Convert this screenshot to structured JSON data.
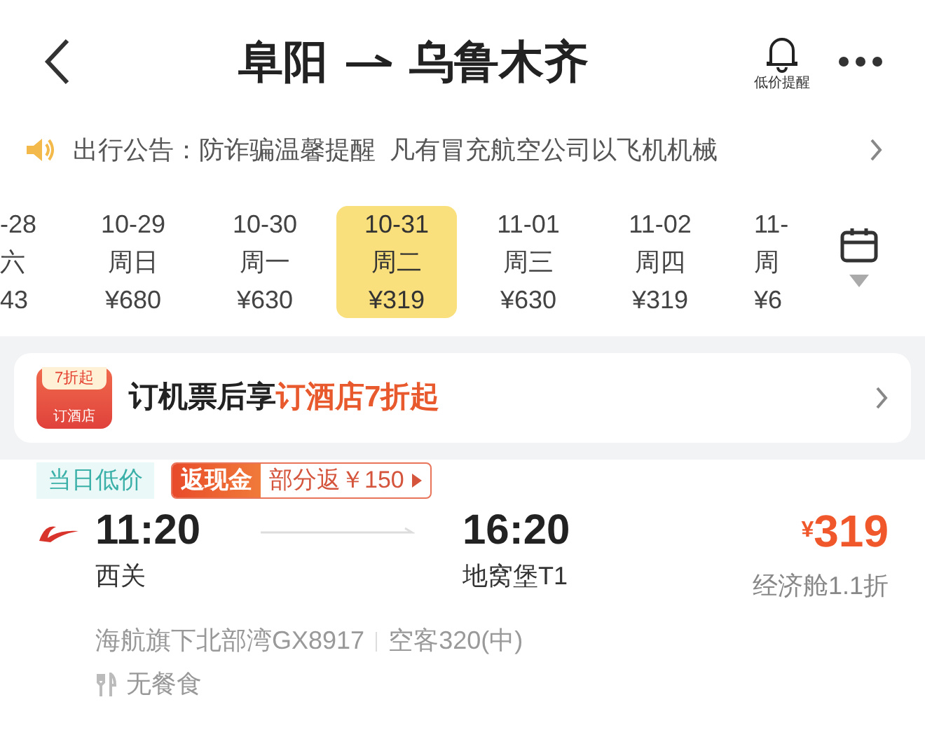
{
  "header": {
    "origin": "阜阳",
    "destination": "乌鲁木齐",
    "price_alert": "低价提醒"
  },
  "notice": {
    "text": "出行公告：防诈骗温馨提醒  凡有冒充航空公司以飞机机械"
  },
  "dates": [
    {
      "date": "-28",
      "weekday": "六",
      "price": "43",
      "selected": false
    },
    {
      "date": "10-29",
      "weekday": "周日",
      "price": "¥680",
      "selected": false
    },
    {
      "date": "10-30",
      "weekday": "周一",
      "price": "¥630",
      "selected": false
    },
    {
      "date": "10-31",
      "weekday": "周二",
      "price": "¥319",
      "selected": true
    },
    {
      "date": "11-01",
      "weekday": "周三",
      "price": "¥630",
      "selected": false
    },
    {
      "date": "11-02",
      "weekday": "周四",
      "price": "¥319",
      "selected": false
    },
    {
      "date": "11-",
      "weekday": "周",
      "price": "¥6",
      "selected": false
    }
  ],
  "promo": {
    "badge_top": "7折起",
    "badge_bottom": "订酒店",
    "text": "订机票后享",
    "highlight": "订酒店7折起"
  },
  "flight": {
    "tags": [
      {
        "kind": "plain",
        "text": "当日低价"
      },
      {
        "kind": "cashback",
        "label": "返现金",
        "text": "部分返￥150"
      }
    ],
    "depart_time": "11:20",
    "depart_airport": "西关",
    "arrive_time": "16:20",
    "arrive_airport": "地窝堡T1",
    "currency": "¥",
    "price": "319",
    "cabin": "经济舱1.1折",
    "airline": "海航旗下北部湾GX8917",
    "aircraft": "空客320(中)",
    "meal": "无餐食"
  }
}
